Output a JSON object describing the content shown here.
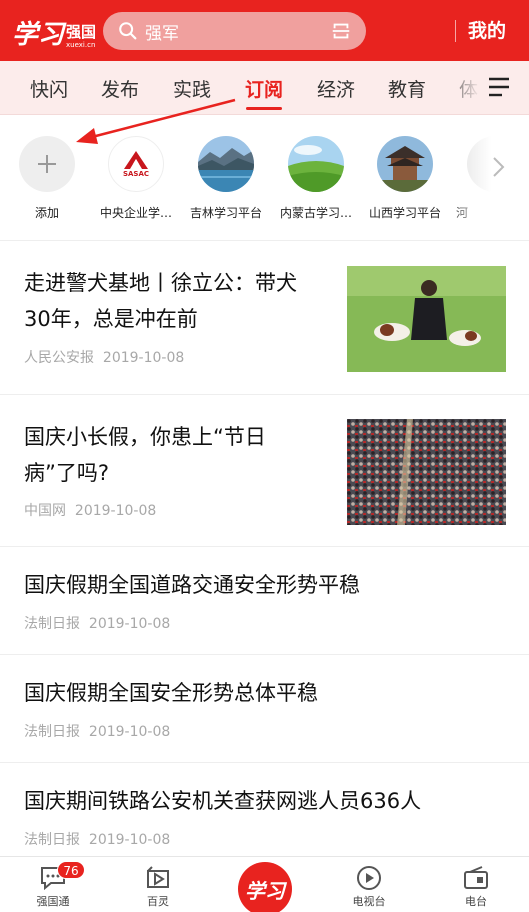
{
  "header": {
    "logo_script": "学习",
    "logo_main": "强国",
    "logo_sub": "xuexi.cn",
    "search_placeholder": "强军",
    "mine_label": "我的",
    "brand_color": "#e8231f"
  },
  "tabs": [
    {
      "label": "快闪",
      "active": false
    },
    {
      "label": "发布",
      "active": false
    },
    {
      "label": "实践",
      "active": false
    },
    {
      "label": "订阅",
      "active": true
    },
    {
      "label": "经济",
      "active": false
    },
    {
      "label": "教育",
      "active": false
    },
    {
      "label": "体",
      "active": false
    }
  ],
  "subscriptions": [
    {
      "label": "添加",
      "icon": "plus-icon"
    },
    {
      "label": "中央企业学…",
      "icon": "sasac-logo"
    },
    {
      "label": "吉林学习平台",
      "icon": "lake-landscape"
    },
    {
      "label": "内蒙古学习…",
      "icon": "grassland-landscape"
    },
    {
      "label": "山西学习平台",
      "icon": "ancient-building"
    },
    {
      "label": "河",
      "icon": "partial-item"
    }
  ],
  "sasac_text": "SASAC",
  "articles": [
    {
      "title_line1": "走进警犬基地丨徐立公：带犬",
      "title_line2": "30年，总是冲在前",
      "source": "人民公安报",
      "date": "2019-10-08",
      "thumb": "police-dogs-photo"
    },
    {
      "title_line1": "国庆小长假，你患上“节日",
      "title_line2": "病”了吗?",
      "source": "中国网",
      "date": "2019-10-08",
      "thumb": "crowd-photo"
    },
    {
      "title_line1": "国庆假期全国道路交通安全形势平稳",
      "source": "法制日报",
      "date": "2019-10-08"
    },
    {
      "title_line1": "国庆假期全国安全形势总体平稳",
      "source": "法制日报",
      "date": "2019-10-08"
    },
    {
      "title_line1": "国庆期间铁路公安机关查获网逃人员636人",
      "source": "法制日报",
      "date": "2019-10-08"
    }
  ],
  "bottom_nav": [
    {
      "label": "强国通",
      "icon": "chat-icon",
      "badge": "76"
    },
    {
      "label": "百灵",
      "icon": "play-box-icon"
    },
    {
      "label": "学习",
      "icon": "xuexi-center-logo"
    },
    {
      "label": "电视台",
      "icon": "play-circle-icon"
    },
    {
      "label": "电台",
      "icon": "radio-icon"
    }
  ]
}
